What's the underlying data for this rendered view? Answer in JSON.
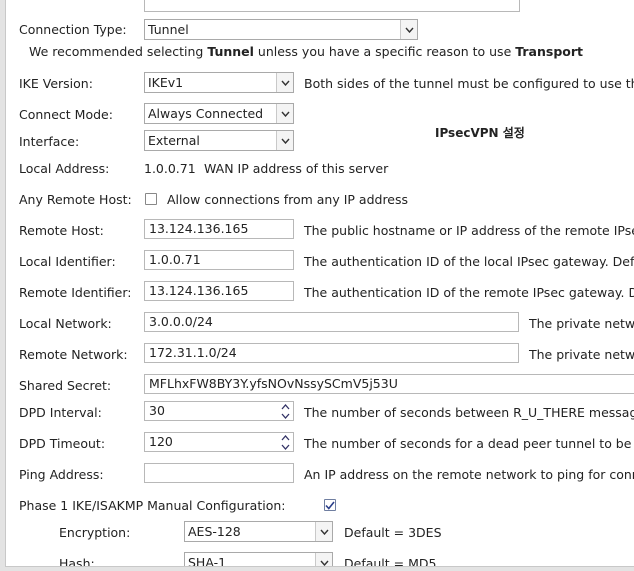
{
  "connection_type": {
    "label": "Connection Type:",
    "value": "Tunnel"
  },
  "recommendation": {
    "prefix": "We recommended selecting ",
    "tunnel": "Tunnel",
    "middle": " unless you have a specific reason to use ",
    "transport": "Transport"
  },
  "ike_version": {
    "label": "IKE Version:",
    "value": "IKEv1",
    "help": "Both sides of the tunnel must be configured to use the"
  },
  "connect_mode": {
    "label": "Connect Mode:",
    "value": "Always Connected"
  },
  "interface": {
    "label": "Interface:",
    "value": "External"
  },
  "annotation": "IPsecVPN 설정",
  "local_address": {
    "label": "Local Address:",
    "value": "1.0.0.71",
    "help": "WAN IP address of this server"
  },
  "any_remote_host": {
    "label": "Any Remote Host:",
    "checked": false,
    "help": "Allow connections from any IP address"
  },
  "remote_host": {
    "label": "Remote Host:",
    "value": "13.124.136.165",
    "help": "The public hostname or IP address of the remote IPsec"
  },
  "local_identifier": {
    "label": "Local Identifier:",
    "value": "1.0.0.71",
    "help": "The authentication ID of the local IPsec gateway. Defau"
  },
  "remote_identifier": {
    "label": "Remote Identifier:",
    "value": "13.124.136.165",
    "help": "The authentication ID of the remote IPsec gateway. De"
  },
  "local_network": {
    "label": "Local Network:",
    "value": "3.0.0.0/24",
    "help": "The private netw"
  },
  "remote_network": {
    "label": "Remote Network:",
    "value": "172.31.1.0/24",
    "help": "The private netw"
  },
  "shared_secret": {
    "label": "Shared Secret:",
    "value": "MFLhxFW8BY3Y.yfsNOvNssySCmV5j53U"
  },
  "dpd_interval": {
    "label": "DPD Interval:",
    "value": "30",
    "help": "The number of seconds between R_U_THERE message"
  },
  "dpd_timeout": {
    "label": "DPD Timeout:",
    "value": "120",
    "help": "The number of seconds for a dead peer tunnel to be re"
  },
  "ping_address": {
    "label": "Ping Address:",
    "value": "",
    "help": "An IP address on the remote network to ping for conne"
  },
  "phase1": {
    "label": "Phase 1 IKE/ISAKMP Manual Configuration:",
    "checked": true
  },
  "encryption": {
    "label": "Encryption:",
    "value": "AES-128",
    "help": "Default = 3DES"
  },
  "hash": {
    "label": "Hash:",
    "value": "SHA-1",
    "help": "Default = MD5"
  }
}
